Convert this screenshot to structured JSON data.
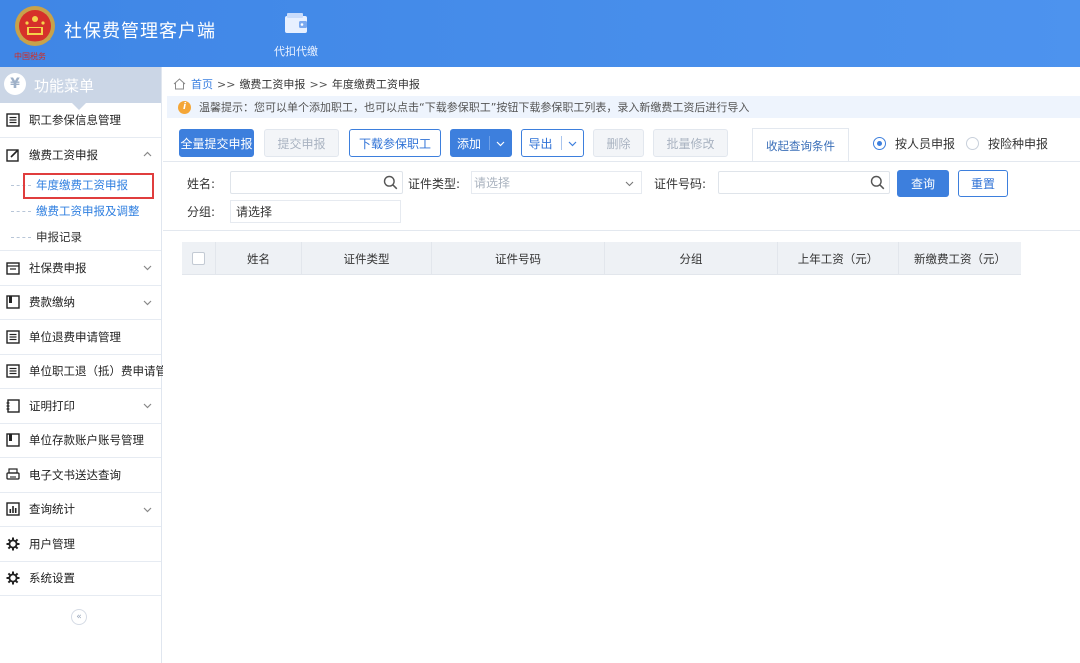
{
  "header": {
    "emblem_text": "中国税务",
    "app_title": "社保费管理客户端",
    "nav_label": "代扣代缴"
  },
  "sidebar": {
    "menu_title": "功能菜单",
    "items": [
      {
        "label": "职工参保信息管理",
        "icon": "list-icon",
        "expandable": false
      },
      {
        "label": "缴费工资申报",
        "icon": "edit-icon",
        "expandable": true,
        "expanded": true
      },
      {
        "label": "社保费申报",
        "icon": "calendar-icon",
        "expandable": true
      },
      {
        "label": "费款缴纳",
        "icon": "book-icon",
        "expandable": true
      },
      {
        "label": "单位退费申请管理",
        "icon": "list-icon",
        "expandable": false
      },
      {
        "label": "单位职工退（抵）费申请管理",
        "icon": "list-icon",
        "expandable": false
      },
      {
        "label": "证明打印",
        "icon": "document-icon",
        "expandable": true
      },
      {
        "label": "单位存款账户账号管理",
        "icon": "book-icon",
        "expandable": false
      },
      {
        "label": "电子文书送达查询",
        "icon": "printer-icon",
        "expandable": false
      },
      {
        "label": "查询统计",
        "icon": "chart-icon",
        "expandable": true
      },
      {
        "label": "用户管理",
        "icon": "gear-icon",
        "expandable": false
      },
      {
        "label": "系统设置",
        "icon": "gear-icon",
        "expandable": false
      }
    ],
    "sub_items": [
      "年度缴费工资申报",
      "缴费工资申报及调整",
      "申报记录"
    ],
    "collapse_glyph": "«"
  },
  "breadcrumb": {
    "home": "首页",
    "sep": ">>",
    "level1": "缴费工资申报",
    "level2": "年度缴费工资申报"
  },
  "tip": {
    "icon_glyph": "i",
    "text": "温馨提示：您可以单个添加职工，也可以点击“下载参保职工”按钮下载参保职工列表，录入新缴费工资后进行导入"
  },
  "toolbar": {
    "submit_all": "全量提交申报",
    "submit": "提交申报",
    "download": "下载参保职工",
    "add": "添加",
    "export": "导出",
    "delete": "删除",
    "batch_edit": "批量修改",
    "collapse_tab": "收起查询条件",
    "radio_person": "按人员申报",
    "radio_insurance": "按险种申报"
  },
  "filter": {
    "name_label": "姓名:",
    "id_type_label": "证件类型:",
    "id_type_placeholder": "请选择",
    "id_number_label": "证件号码:",
    "group_label": "分组:",
    "group_value": "请选择",
    "query": "查询",
    "reset": "重置"
  },
  "table": {
    "columns": [
      "姓名",
      "证件类型",
      "证件号码",
      "分组",
      "上年工资（元）",
      "新缴费工资（元）"
    ]
  },
  "colors": {
    "header_bg": "#4a8fec",
    "primary": "#3d7fdd",
    "highlight_border": "#e03d3d"
  }
}
